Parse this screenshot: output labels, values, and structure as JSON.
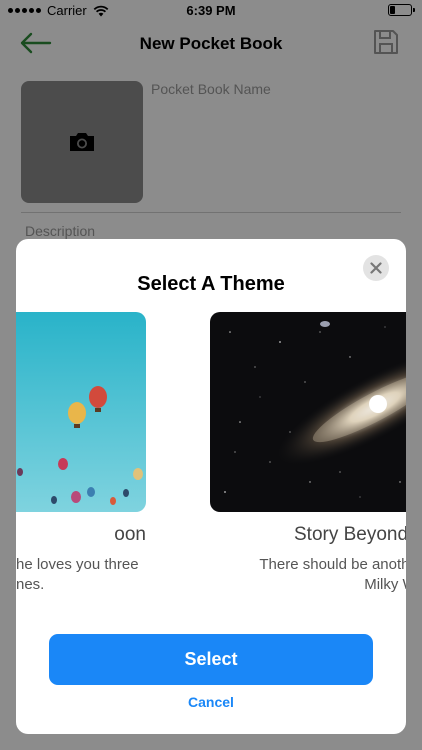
{
  "status_bar": {
    "carrier": "Carrier",
    "time": "6:39 PM",
    "battery_level": 0.25
  },
  "nav": {
    "title": "New Pocket Book",
    "back_icon": "arrow-left-icon",
    "save_icon": "floppy-disk-icon",
    "accent_color": "#2e8b3a"
  },
  "form": {
    "name_placeholder": "Pocket Book Name",
    "name_value": "",
    "description_placeholder": "Description",
    "description_value": "",
    "photo_icon": "camera-icon"
  },
  "modal": {
    "title": "Select A Theme",
    "close_icon": "close-icon",
    "themes": [
      {
        "name": "oon",
        "description_line1": "he loves you three",
        "description_line2": "nes."
      },
      {
        "name": "Story Beyond",
        "description_line1": "There should be another r",
        "description_line2": "Milky Way"
      }
    ],
    "select_label": "Select",
    "cancel_label": "Cancel",
    "button_color": "#1a87f7"
  }
}
